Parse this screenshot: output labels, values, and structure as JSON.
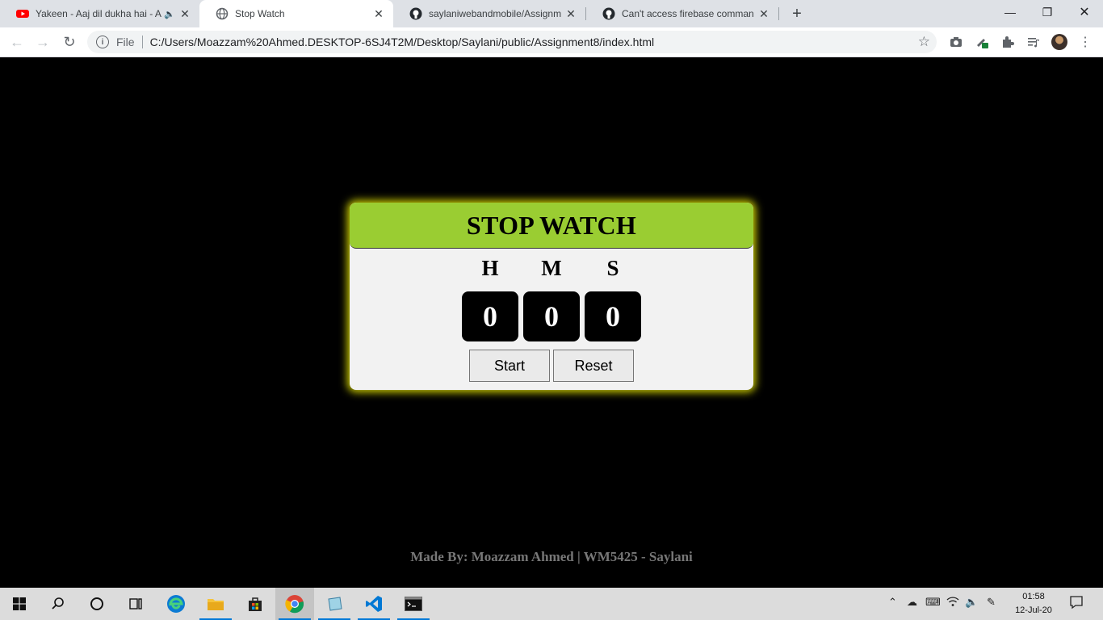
{
  "browser": {
    "tabs": [
      {
        "title": "Yakeen - Aaj dil dukha hai - A",
        "favicon": "youtube-icon",
        "audio": true
      },
      {
        "title": "Stop Watch",
        "favicon": "globe-icon",
        "active": true
      },
      {
        "title": "saylaniwebandmobile/Assignmen",
        "favicon": "github-icon"
      },
      {
        "title": "Can't access firebase command a",
        "favicon": "github-icon"
      }
    ],
    "address": {
      "scheme": "File",
      "url": "C:/Users/Moazzam%20Ahmed.DESKTOP-6SJ4T2M/Desktop/Saylani/public/Assignment8/index.html"
    }
  },
  "stopwatch": {
    "title": "STOP WATCH",
    "labels": {
      "hours": "H",
      "minutes": "M",
      "seconds": "S"
    },
    "values": {
      "hours": "0",
      "minutes": "0",
      "seconds": "0"
    },
    "buttons": {
      "start": "Start",
      "reset": "Reset"
    },
    "accent_color": "#9acd32",
    "glow_color": "#c8c800"
  },
  "footer": {
    "text": "Made By: Moazzam Ahmed | WM5425 - Saylani"
  },
  "taskbar": {
    "clock": {
      "time": "01:58",
      "date": "12-Jul-20"
    },
    "apps": [
      "start-icon",
      "search-icon",
      "cortana-icon",
      "task-view-icon",
      "edge-icon",
      "file-explorer-icon",
      "store-icon",
      "chrome-icon",
      "notepad-icon",
      "vscode-icon",
      "terminal-icon"
    ]
  }
}
